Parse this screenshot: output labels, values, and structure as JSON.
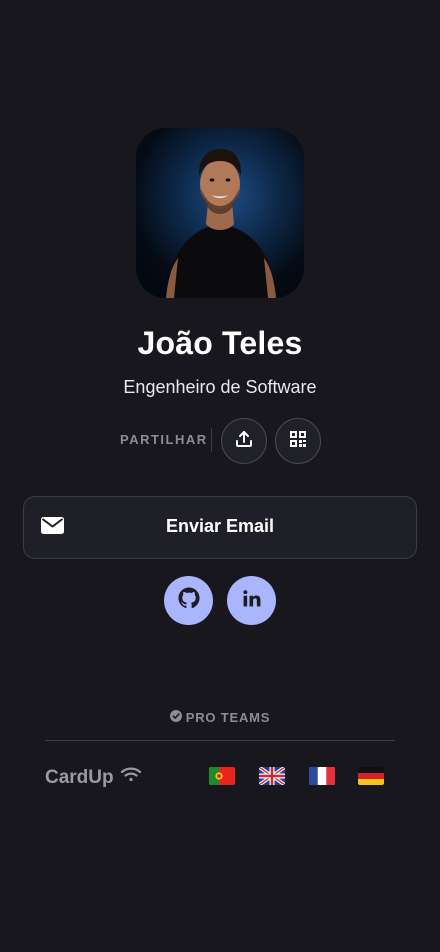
{
  "profile": {
    "name": "João Teles",
    "role": "Engenheiro de Software",
    "avatar_icon": "profile-photo"
  },
  "share": {
    "label": "PARTILHAR",
    "buttons": [
      {
        "icon": "share-upload-icon"
      },
      {
        "icon": "qr-code-icon"
      }
    ]
  },
  "actions": {
    "email_label": "Enviar Email",
    "email_icon": "envelope-icon"
  },
  "social": [
    {
      "icon": "github-icon"
    },
    {
      "icon": "linkedin-icon"
    }
  ],
  "footer": {
    "badge": "PRO TEAMS",
    "brand": "CardUp",
    "languages": [
      {
        "icon": "portugal-flag-icon"
      },
      {
        "icon": "uk-flag-icon"
      },
      {
        "icon": "france-flag-icon"
      },
      {
        "icon": "germany-flag-icon"
      }
    ]
  },
  "colors": {
    "background": "#17171d",
    "accent": "#aab6fb",
    "muted_text": "#8c8c96"
  }
}
